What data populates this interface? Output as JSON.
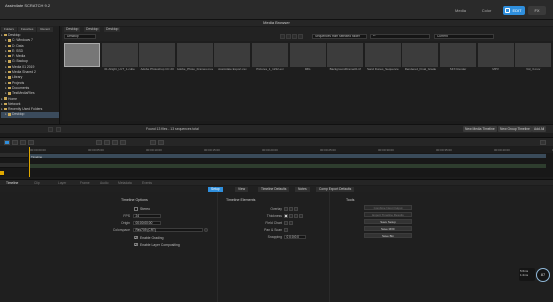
{
  "app": {
    "title": "Assimilate SCRATCH 9.2"
  },
  "mode_tabs": {
    "media": "Media",
    "color": "Color",
    "edit": "EDIT",
    "fx": "FX"
  },
  "media_browser": {
    "header": "Media Browser",
    "sidebar_tabs": [
      "Folders",
      "Favorites",
      "Recent"
    ],
    "tree": [
      {
        "label": "Desktop",
        "level": 0
      },
      {
        "label": "C: Windows 7",
        "level": 1
      },
      {
        "label": "D: Data",
        "level": 1
      },
      {
        "label": "E: SSD",
        "level": 1
      },
      {
        "label": "F: Media",
        "level": 1
      },
      {
        "label": "G: Backup",
        "level": 1
      },
      {
        "label": "Media 01 2019",
        "level": 1
      },
      {
        "label": "Media Shared 2",
        "level": 1
      },
      {
        "label": "Library",
        "level": 1
      },
      {
        "label": "Projects",
        "level": 1
      },
      {
        "label": "Documents",
        "level": 1
      },
      {
        "label": "TestMediaFiles",
        "level": 1
      },
      {
        "label": "Home",
        "level": 0
      },
      {
        "label": "Network",
        "level": 0
      },
      {
        "label": "Recently Used Folders",
        "level": 0
      },
      {
        "label": "Desktop",
        "level": 1,
        "selected": true
      }
    ],
    "tabs": [
      "Desktop",
      "Desktop",
      "Desktop"
    ],
    "path_label": "Desktop",
    "sequence_mode": "Sequences from selected folder",
    "filter": "**",
    "sort": "Current",
    "thumbs": [
      {
        "label": "...",
        "selected": true
      },
      {
        "label": "01 Alright_LUT_1.cube"
      },
      {
        "label": "Adobe Photoshop CC 20"
      },
      {
        "label": "Adobe_Photo_Frames.mov"
      },
      {
        "label": "Assimilate Export.csv"
      },
      {
        "label": "Pictures_1_1232.exr"
      },
      {
        "label": "IMG"
      },
      {
        "label": "BackgroundFrame01.tif"
      },
      {
        "label": "Sand Dunes_Sequence"
      },
      {
        "label": "Rendered_Final_Grade"
      },
      {
        "label": "SFX Render"
      },
      {
        "label": "MPV"
      },
      {
        "label": "Vid_3.mov"
      }
    ],
    "found_text": "Found 13 files - 13 sequences total",
    "buttons": {
      "new_media_timeline": "New Media Timeline",
      "new_group_timeline": "New Group Timeline",
      "add": "Add All"
    }
  },
  "timeline": {
    "timecodes": [
      "00:00:00:00",
      "00:00:05:00",
      "00:00:10:00",
      "00:00:15:00",
      "00:00:20:00",
      "00:00:25:00",
      "00:00:30:00",
      "00:00:35:00",
      "00:00:40:00",
      "00:00:45:00"
    ],
    "track_label": "Timeline"
  },
  "inspector": {
    "tabs": [
      "Timeline",
      "Clip",
      "Layer",
      "Frame",
      "Audio",
      "Metadata",
      "Events"
    ],
    "settings_tabs": [
      "Setup",
      "View",
      "Timeline Defaults",
      "Notes",
      "Comp Export Defaults"
    ],
    "timeline_options": {
      "title": "Timeline Options",
      "stereo_label": "Stereo",
      "fps_label": "FPS",
      "fps_value": "24",
      "origin_label": "Origin",
      "origin_value": "00:00:00:00",
      "colorspace_label": "Colorspace",
      "colorspace_value": "Rec709 (CRT)",
      "enable_grading": "Enable Grading",
      "enable_layer_compositing": "Enable Layer Compositing"
    },
    "timeline_elements": {
      "title": "Timeline Elements",
      "overlay_label": "Overlay",
      "thickness_label": "Thickness",
      "field_chart_label": "Field Chart",
      "pan_scan_label": "Pan & Scan",
      "snapping_label": "Snapping",
      "snapping_value": "0 0:0:0:0"
    },
    "tools": {
      "title": "Tools",
      "buttons": [
        "Combine Nest Output",
        "Export Timeline Results",
        "Save Setup",
        "Save MXF",
        "Save Bin"
      ]
    }
  },
  "performance": {
    "line1": "5:6ms",
    "line2": "1:2ms",
    "gauge": "87"
  }
}
